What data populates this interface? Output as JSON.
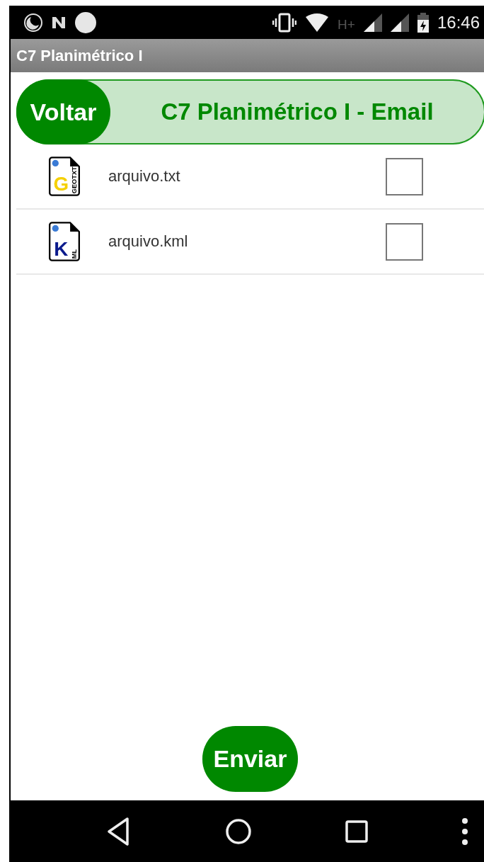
{
  "status_bar": {
    "network": "H+",
    "time": "16:46"
  },
  "app_bar": {
    "title": "C7 Planimétrico I"
  },
  "header": {
    "back_button": "Voltar",
    "title": "C7 Planimétrico I - Email"
  },
  "files": [
    {
      "name": "arquivo.txt",
      "icon_letter": "G",
      "icon_tag": "GEOTXT",
      "color": "#f5d000",
      "checked": false
    },
    {
      "name": "arquivo.kml",
      "icon_letter": "K",
      "icon_tag": "ML",
      "color": "#0a1a8c",
      "checked": false
    }
  ],
  "send_button": "Enviar"
}
